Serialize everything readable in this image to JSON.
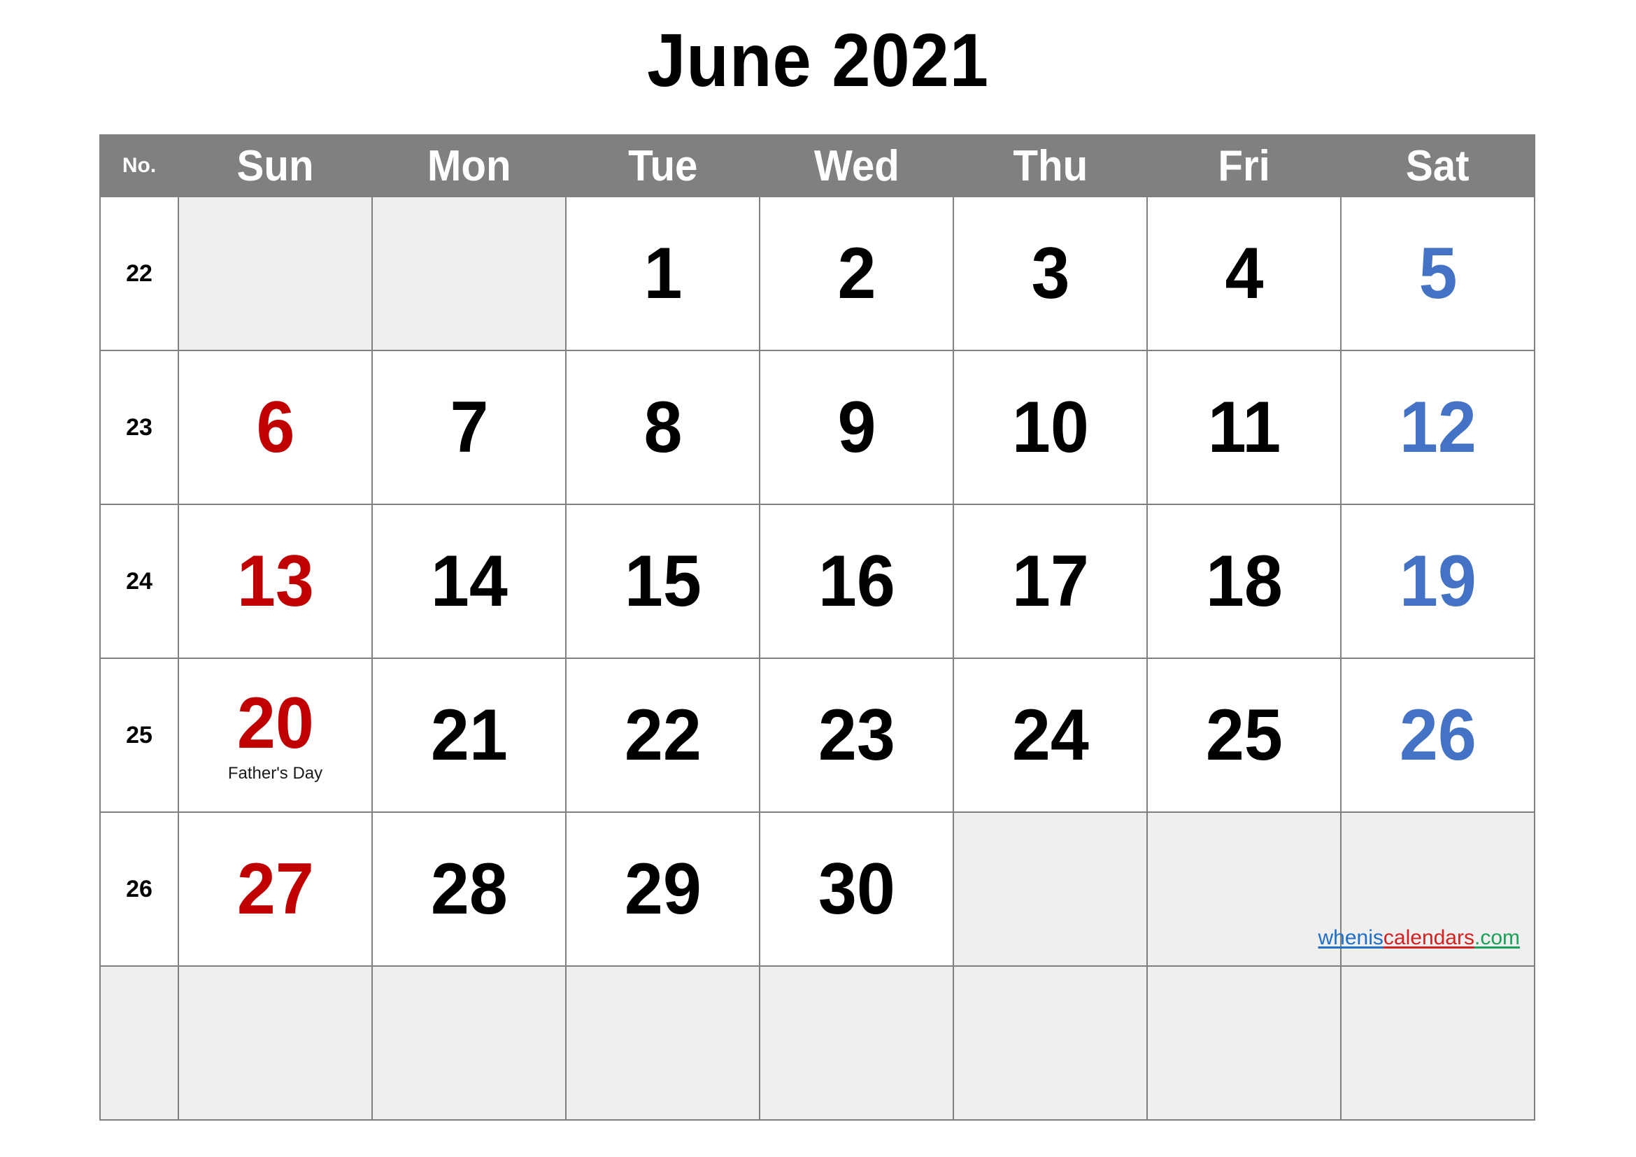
{
  "title": "June 2021",
  "month": "June",
  "year": "2021",
  "header": {
    "week_col_label": "No.",
    "days": [
      "Sun",
      "Mon",
      "Tue",
      "Wed",
      "Thu",
      "Fri",
      "Sat"
    ]
  },
  "colors": {
    "header_bg": "#808080",
    "header_text": "#ffffff",
    "grid_line": "#808080",
    "empty_cell": "#efefef",
    "sunday": "#C00000",
    "saturday": "#4472C4",
    "weekday": "#000000"
  },
  "weeks": [
    {
      "no": "22",
      "no_blank": false,
      "days": [
        {
          "num": "",
          "kind": "empty",
          "note": ""
        },
        {
          "num": "",
          "kind": "empty",
          "note": ""
        },
        {
          "num": "1",
          "kind": "weekday",
          "note": ""
        },
        {
          "num": "2",
          "kind": "weekday",
          "note": ""
        },
        {
          "num": "3",
          "kind": "weekday",
          "note": ""
        },
        {
          "num": "4",
          "kind": "weekday",
          "note": ""
        },
        {
          "num": "5",
          "kind": "saturday",
          "note": ""
        }
      ]
    },
    {
      "no": "23",
      "no_blank": false,
      "days": [
        {
          "num": "6",
          "kind": "sunday",
          "note": ""
        },
        {
          "num": "7",
          "kind": "weekday",
          "note": ""
        },
        {
          "num": "8",
          "kind": "weekday",
          "note": ""
        },
        {
          "num": "9",
          "kind": "weekday",
          "note": ""
        },
        {
          "num": "10",
          "kind": "weekday",
          "note": ""
        },
        {
          "num": "11",
          "kind": "weekday",
          "note": ""
        },
        {
          "num": "12",
          "kind": "saturday",
          "note": ""
        }
      ]
    },
    {
      "no": "24",
      "no_blank": false,
      "days": [
        {
          "num": "13",
          "kind": "sunday",
          "note": ""
        },
        {
          "num": "14",
          "kind": "weekday",
          "note": ""
        },
        {
          "num": "15",
          "kind": "weekday",
          "note": ""
        },
        {
          "num": "16",
          "kind": "weekday",
          "note": ""
        },
        {
          "num": "17",
          "kind": "weekday",
          "note": ""
        },
        {
          "num": "18",
          "kind": "weekday",
          "note": ""
        },
        {
          "num": "19",
          "kind": "saturday",
          "note": ""
        }
      ]
    },
    {
      "no": "25",
      "no_blank": false,
      "days": [
        {
          "num": "20",
          "kind": "sunday",
          "note": "Father's Day"
        },
        {
          "num": "21",
          "kind": "weekday",
          "note": ""
        },
        {
          "num": "22",
          "kind": "weekday",
          "note": ""
        },
        {
          "num": "23",
          "kind": "weekday",
          "note": ""
        },
        {
          "num": "24",
          "kind": "weekday",
          "note": ""
        },
        {
          "num": "25",
          "kind": "weekday",
          "note": ""
        },
        {
          "num": "26",
          "kind": "saturday",
          "note": ""
        }
      ]
    },
    {
      "no": "26",
      "no_blank": false,
      "days": [
        {
          "num": "27",
          "kind": "sunday",
          "note": ""
        },
        {
          "num": "28",
          "kind": "weekday",
          "note": ""
        },
        {
          "num": "29",
          "kind": "weekday",
          "note": ""
        },
        {
          "num": "30",
          "kind": "weekday",
          "note": ""
        },
        {
          "num": "",
          "kind": "empty",
          "note": ""
        },
        {
          "num": "",
          "kind": "empty",
          "note": ""
        },
        {
          "num": "",
          "kind": "empty",
          "note": ""
        }
      ]
    },
    {
      "no": "",
      "no_blank": true,
      "days": [
        {
          "num": "",
          "kind": "empty",
          "note": ""
        },
        {
          "num": "",
          "kind": "empty",
          "note": ""
        },
        {
          "num": "",
          "kind": "empty",
          "note": ""
        },
        {
          "num": "",
          "kind": "empty",
          "note": ""
        },
        {
          "num": "",
          "kind": "empty",
          "note": ""
        },
        {
          "num": "",
          "kind": "empty",
          "note": ""
        },
        {
          "num": "",
          "kind": "empty",
          "note": ""
        }
      ]
    }
  ],
  "watermark": {
    "part1": "whenis",
    "part2": "calendars",
    "part3": ".com"
  }
}
